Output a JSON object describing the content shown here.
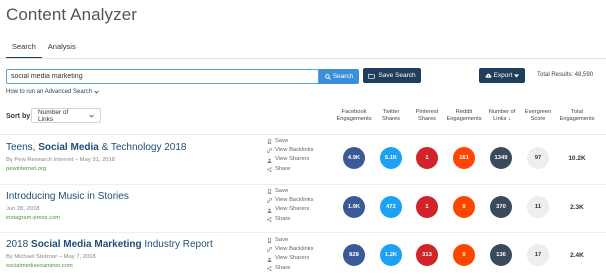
{
  "app": {
    "title": "Content Analyzer"
  },
  "tabs": [
    {
      "label": "Search",
      "active": true
    },
    {
      "label": "Analysis",
      "active": false
    }
  ],
  "search": {
    "value": "social media marketing",
    "placeholder": "",
    "button_label": "Search",
    "save_label": "Save Search",
    "export_label": "Export",
    "total_results": "Total Results: 48,590",
    "advanced_link": "How to run an Advanced Search"
  },
  "sort": {
    "label": "Sort by",
    "selected": "Number of Links"
  },
  "columns": {
    "facebook": "Facebook Engagements",
    "twitter": "Twitter Shares",
    "pinterest": "Pinterest Shares",
    "reddit": "Reddit Engagements",
    "links": "Number of Links ↓",
    "evergreen": "Evergreen Score",
    "total": "Total Engagements"
  },
  "action_labels": {
    "save": "Save",
    "backlinks": "View Backlinks",
    "sharers": "View Sharers",
    "share": "Share"
  },
  "colors": {
    "facebook": "#3b5998",
    "twitter": "#1da1f2",
    "pinterest": "#d0232a",
    "reddit": "#ff4500",
    "links": "#3a4a5a",
    "evergreen": "#eceeef",
    "primary_button": "#1f3e5e",
    "search_button": "#3b8fd9",
    "domain": "#4a9a3a"
  },
  "results": [
    {
      "title_parts": [
        {
          "text": "Teens, ",
          "bold": false
        },
        {
          "text": "Social Media",
          "bold": true
        },
        {
          "text": " & Technology 2018",
          "bold": false
        }
      ],
      "meta": "By Pew Research Internet – May 31, 2018",
      "domain": "pewinternet.org",
      "facebook": "4.9K",
      "twitter": "5.1K",
      "pinterest": "1",
      "reddit": "161",
      "links": "1349",
      "evergreen": "97",
      "total": "10.2K"
    },
    {
      "title_parts": [
        {
          "text": "Introducing Music in Stories",
          "bold": false
        }
      ],
      "meta": "Jun 28, 2018",
      "domain": "instagram-press.com",
      "facebook": "1.9K",
      "twitter": "472",
      "pinterest": "1",
      "reddit": "0",
      "links": "370",
      "evergreen": "11",
      "total": "2.3K"
    },
    {
      "title_parts": [
        {
          "text": "2018 ",
          "bold": false
        },
        {
          "text": "Social Media Marketing",
          "bold": true
        },
        {
          "text": " Industry Report",
          "bold": false
        }
      ],
      "meta": "By Michael Stelzner – May 7, 2018",
      "domain": "socialmediaexaminer.com",
      "facebook": "828",
      "twitter": "1.2K",
      "pinterest": "313",
      "reddit": "0",
      "links": "136",
      "evergreen": "17",
      "total": "2.4K"
    }
  ]
}
